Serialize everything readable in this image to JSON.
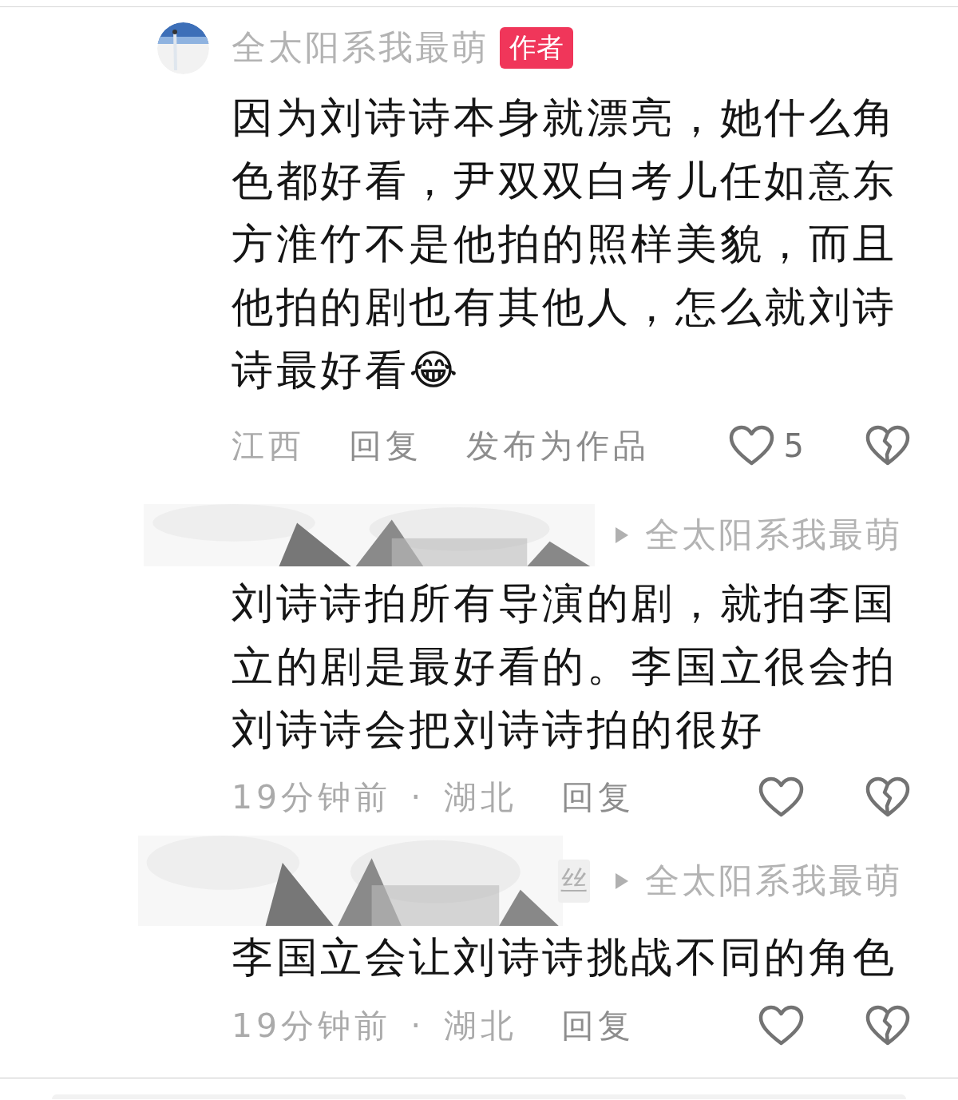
{
  "comment": {
    "author": "全太阳系我最萌",
    "badge": "作者",
    "text": "因为刘诗诗本身就漂亮，她什么角色都好看，尹双双白考儿任如意东方淮竹不是他拍的照样美貌，而且他拍的剧也有其他人，怎么就刘诗诗最好看😂",
    "location": "江西",
    "actions": [
      "回复",
      "发布为作品"
    ],
    "likes": "5"
  },
  "replies": [
    {
      "reply_to": "全太阳系我最萌",
      "text": "刘诗诗拍所有导演的剧，就拍李国立的剧是最好看的。李国立很会拍刘诗诗会把刘诗诗拍的很好",
      "time": "19分钟前",
      "separator": "·",
      "location": "湖北",
      "action": "回复"
    },
    {
      "badge_fragment": "丝",
      "reply_to": "全太阳系我最萌",
      "text": "李国立会让刘诗诗挑战不同的角色",
      "time": "19分钟前",
      "separator": "·",
      "location": "湖北",
      "action": "回复"
    }
  ]
}
